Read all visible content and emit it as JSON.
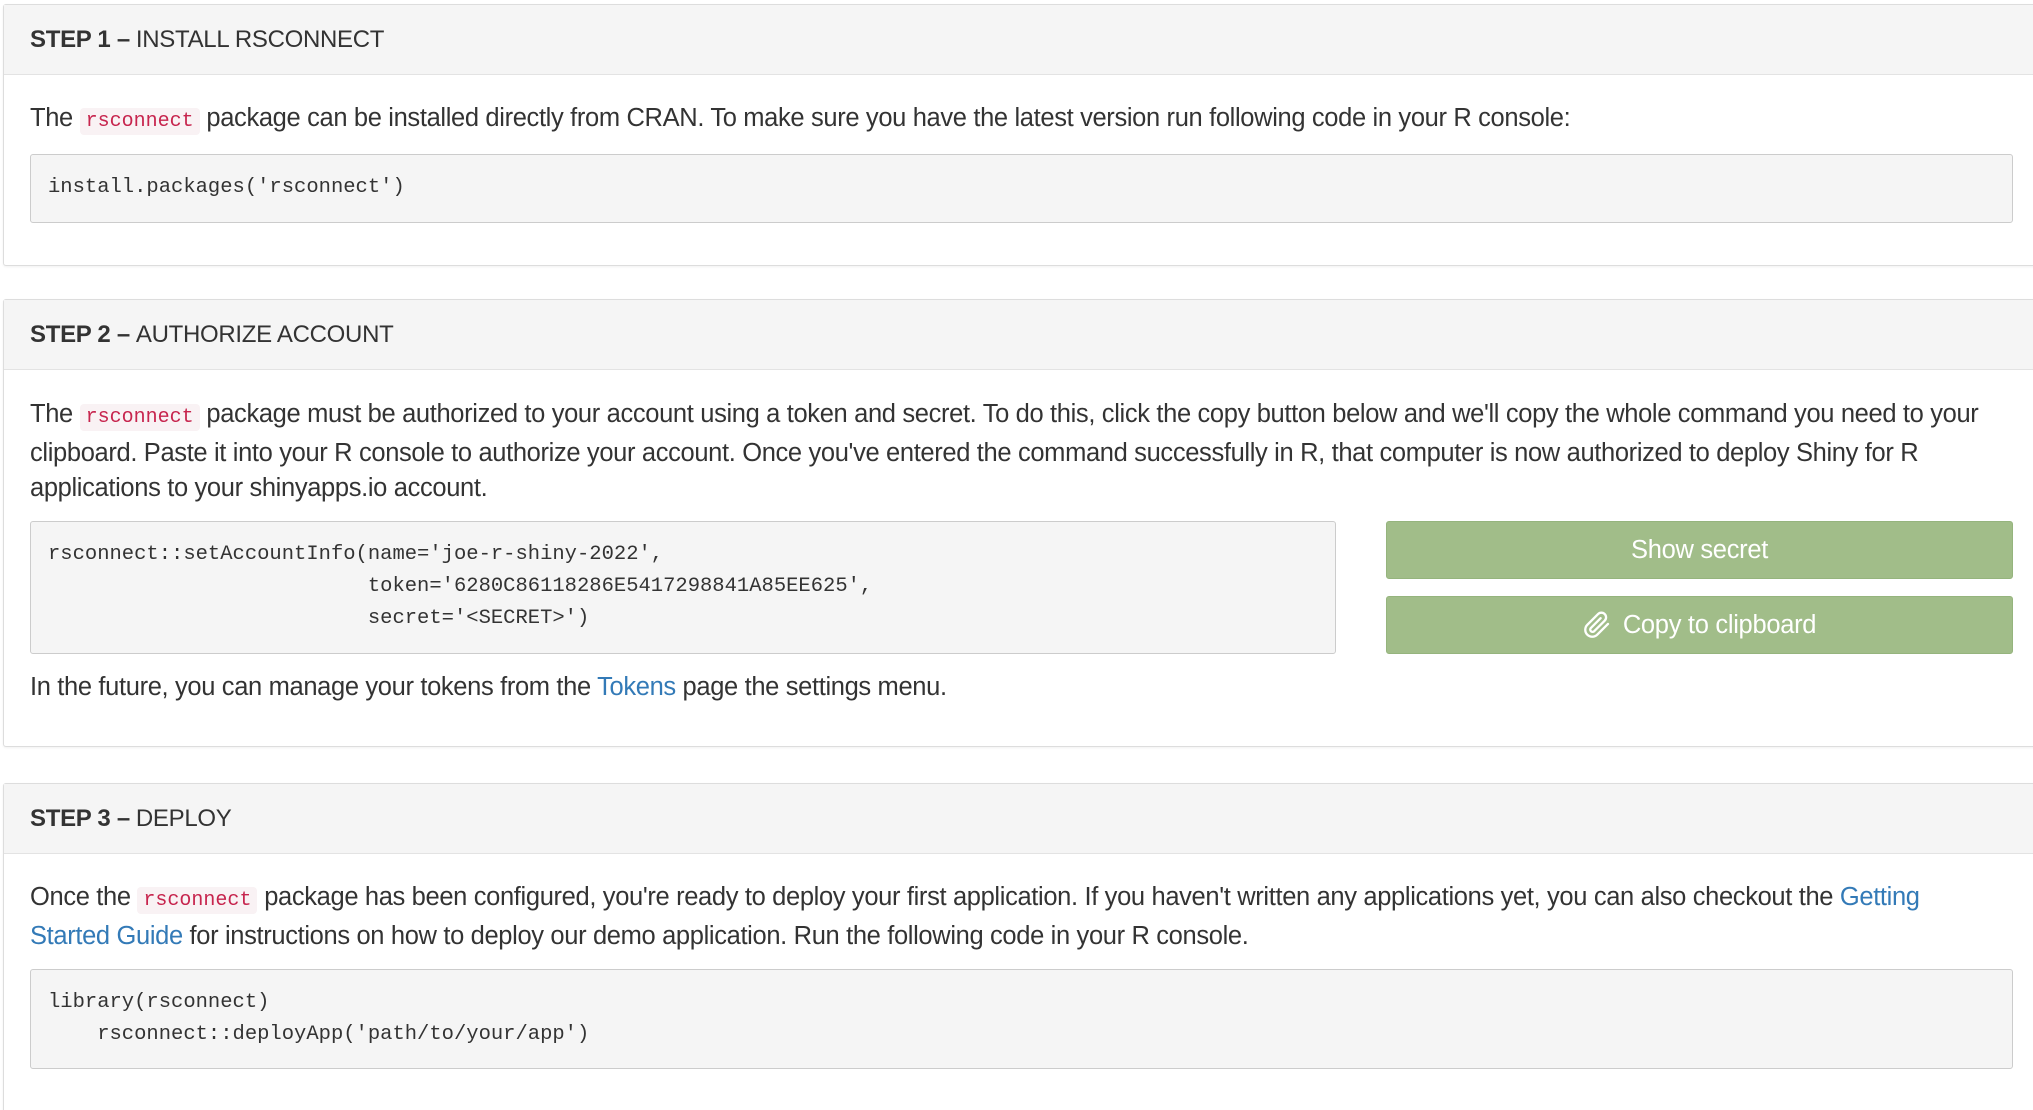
{
  "step1": {
    "label": "STEP 1 –",
    "title": "INSTALL RSCONNECT",
    "para_before": "The ",
    "package": "rsconnect",
    "para_after": " package can be installed directly from CRAN. To make sure you have the latest version run following code in your R console:",
    "code": "install.packages('rsconnect')"
  },
  "step2": {
    "label": "STEP 2 –",
    "title": "AUTHORIZE ACCOUNT",
    "para_before": "The ",
    "package": "rsconnect",
    "para_after": " package must be authorized to your account using a token and secret. To do this, click the copy button below and we'll copy the whole command you need to your clipboard. Paste it into your R console to authorize your account. Once you've entered the command successfully in R, that computer is now authorized to deploy Shiny for R applications to your shinyapps.io account.",
    "code": "rsconnect::setAccountInfo(name='joe-r-shiny-2022',\n                          token='6280C86118286E5417298841A85EE625',\n                          secret='<SECRET>')",
    "show_secret_label": "Show secret",
    "copy_label": "Copy to clipboard",
    "copy_icon": "paperclip-icon",
    "footer_before": "In the future, you can manage your tokens from the ",
    "footer_link": "Tokens",
    "footer_after": " page the settings menu."
  },
  "step3": {
    "label": "STEP 3 –",
    "title": "DEPLOY",
    "para_before": "Once the ",
    "package": "rsconnect",
    "para_middle": " package has been configured, you're ready to deploy your first application. If you haven't written any applications yet, you can also checkout the ",
    "guide_link": "Getting Started Guide",
    "para_after": " for instructions on how to deploy our demo application. Run the following code in your R console.",
    "code": "library(rsconnect)\n    rsconnect::deployApp('path/to/your/app')"
  },
  "colors": {
    "button_bg": "#a1bd89",
    "link": "#337ab7",
    "inline_code": "#c7254e"
  }
}
